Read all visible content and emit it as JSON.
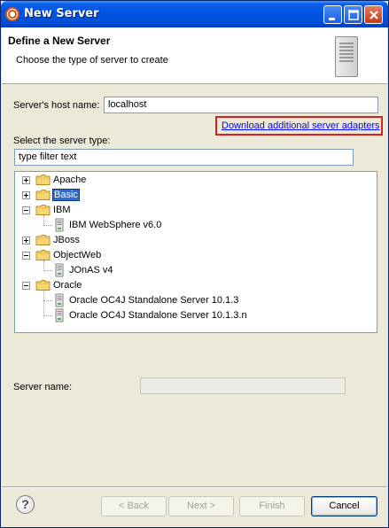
{
  "window": {
    "title": "New Server"
  },
  "header": {
    "title": "Define a New Server",
    "subtitle": "Choose the type of server to create"
  },
  "form": {
    "host_label": "Server's host name:",
    "host_value": "localhost",
    "download_link": "Download additional server adapters",
    "type_label": "Select the server type:",
    "filter_placeholder": "type filter text",
    "name_label": "Server name:",
    "name_value": ""
  },
  "tree": {
    "categories": [
      {
        "label": "Apache",
        "expanded": false,
        "selected": false,
        "children": []
      },
      {
        "label": "Basic",
        "expanded": false,
        "selected": true,
        "children": []
      },
      {
        "label": "IBM",
        "expanded": true,
        "selected": false,
        "children": [
          "IBM WebSphere v6.0"
        ]
      },
      {
        "label": "JBoss",
        "expanded": false,
        "selected": false,
        "children": []
      },
      {
        "label": "ObjectWeb",
        "expanded": true,
        "selected": false,
        "children": [
          "JOnAS v4"
        ]
      },
      {
        "label": "Oracle",
        "expanded": true,
        "selected": false,
        "children": [
          "Oracle OC4J Standalone Server 10.1.3",
          "Oracle OC4J Standalone Server 10.1.3.n"
        ]
      }
    ]
  },
  "buttons": {
    "back": "< Back",
    "next": "Next >",
    "finish": "Finish",
    "cancel": "Cancel",
    "help": "?"
  },
  "colors": {
    "selection": "#316ac5",
    "link": "#0000ff",
    "highlight_border": "#d32020"
  }
}
